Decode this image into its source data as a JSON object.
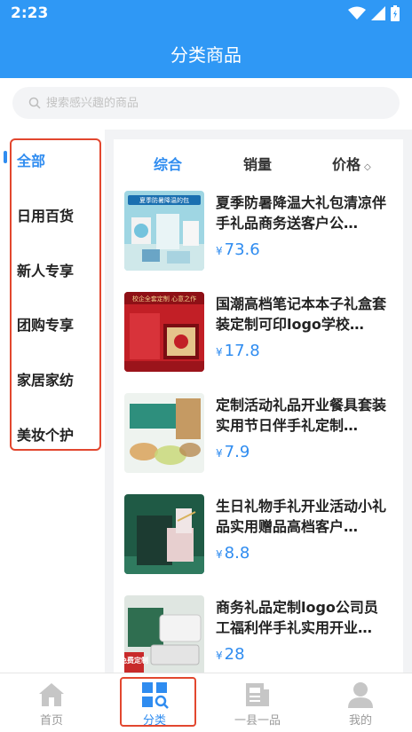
{
  "status": {
    "time": "2:23"
  },
  "header": {
    "title": "分类商品"
  },
  "search": {
    "placeholder": "搜索感兴趣的商品"
  },
  "categories": [
    {
      "label": "全部",
      "active": true
    },
    {
      "label": "日用百货"
    },
    {
      "label": "新人专享"
    },
    {
      "label": "团购专享"
    },
    {
      "label": "家居家纺"
    },
    {
      "label": "美妆个护"
    }
  ],
  "sort": {
    "tabs": [
      "综合",
      "销量",
      "价格"
    ],
    "price_arrow": "◇"
  },
  "products": [
    {
      "name": "夏季防暑降温大礼包清凉伴手礼品商务送客户公…",
      "currency": "¥",
      "price": "73.6",
      "thumb_caption": "夏季防暑降温的包"
    },
    {
      "name": "国潮高档笔记本本子礼盒套装定制可印logo学校…",
      "currency": "¥",
      "price": "17.8",
      "thumb_caption": "校企全套定制 心意之作"
    },
    {
      "name": "定制活动礼品开业餐具套装实用节日伴手礼定制…",
      "currency": "¥",
      "price": "7.9"
    },
    {
      "name": "生日礼物手礼开业活动小礼品实用赠品高档客户…",
      "currency": "¥",
      "price": "8.8"
    },
    {
      "name": "商务礼品定制logo公司员工福利伴手礼实用开业…",
      "currency": "¥",
      "price": "28",
      "thumb_caption": "免费定制"
    }
  ],
  "tabbar": [
    {
      "label": "首页",
      "icon": "home-icon"
    },
    {
      "label": "分类",
      "icon": "category-icon",
      "active": true
    },
    {
      "label": "一县一品",
      "icon": "news-icon"
    },
    {
      "label": "我的",
      "icon": "user-icon"
    }
  ],
  "colors": {
    "primary": "#2f98f5",
    "highlight": "#e2472f",
    "price": "#2f8cf0"
  }
}
